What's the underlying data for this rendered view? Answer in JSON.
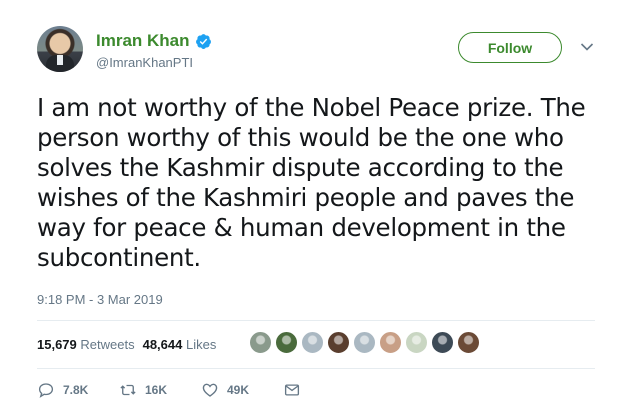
{
  "user": {
    "display_name": "Imran Khan",
    "handle": "@ImranKhanPTI",
    "verified": true
  },
  "follow_button": {
    "label": "Follow"
  },
  "tweet": {
    "lines": [
      "I am not worthy of the Nobel Peace prize. The",
      "person worthy of this would be the one who",
      "solves the Kashmir dispute according to the",
      "wishes of the Kashmiri people and paves the",
      "way for peace & human development in the",
      "subcontinent."
    ],
    "timestamp": "9:18 PM - 3 Mar 2019"
  },
  "stats": {
    "retweets_count": "15,679",
    "retweets_label": "Retweets",
    "likes_count": "48,644",
    "likes_label": "Likes"
  },
  "likers": [
    {
      "color": "#8a9a8c"
    },
    {
      "color": "#4a6b3c"
    },
    {
      "color": "#aab8c2"
    },
    {
      "color": "#5a3e2e"
    },
    {
      "color": "#aab8c2"
    },
    {
      "color": "#c89f86"
    },
    {
      "color": "#c9d6c2"
    },
    {
      "color": "#3d4a56"
    },
    {
      "color": "#6b4a36"
    }
  ],
  "actions": {
    "reply_count": "7.8K",
    "retweet_count": "16K",
    "like_count": "49K"
  },
  "colors": {
    "accent": "#3c8a2e",
    "verified_blue": "#1da1f2",
    "muted": "#657786"
  },
  "icons": [
    "verified-badge-icon",
    "chevron-down-icon",
    "reply-icon",
    "retweet-icon",
    "heart-icon",
    "message-icon"
  ]
}
